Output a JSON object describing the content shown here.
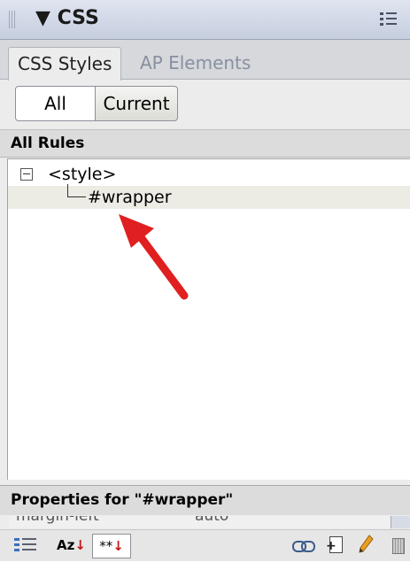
{
  "panel": {
    "title": "CSS"
  },
  "tabs": [
    {
      "label": "CSS Styles",
      "active": true
    },
    {
      "label": "AP Elements",
      "active": false
    }
  ],
  "mode_toggle": {
    "all_label": "All",
    "current_label": "Current",
    "selected": "All"
  },
  "rules": {
    "header": "All Rules",
    "tree": [
      {
        "label": "<style>",
        "expanded": true,
        "toggle_glyph": "minus"
      },
      {
        "label": "#wrapper",
        "selected": true
      }
    ]
  },
  "annotation": {
    "color": "#e02020",
    "icon": "red-arrow"
  },
  "properties": {
    "header": "Properties for \"#wrapper\"",
    "rows": [
      {
        "name": "margin-left",
        "value": "auto"
      }
    ]
  },
  "toolbar": {
    "list_glyph": "Az",
    "set_glyph": "**",
    "icons": [
      "show-category-view-icon",
      "show-list-view-icon",
      "show-set-properties-icon",
      "attach-style-sheet-icon",
      "new-css-rule-icon",
      "edit-style-icon",
      "delete-css-rule-icon"
    ]
  }
}
